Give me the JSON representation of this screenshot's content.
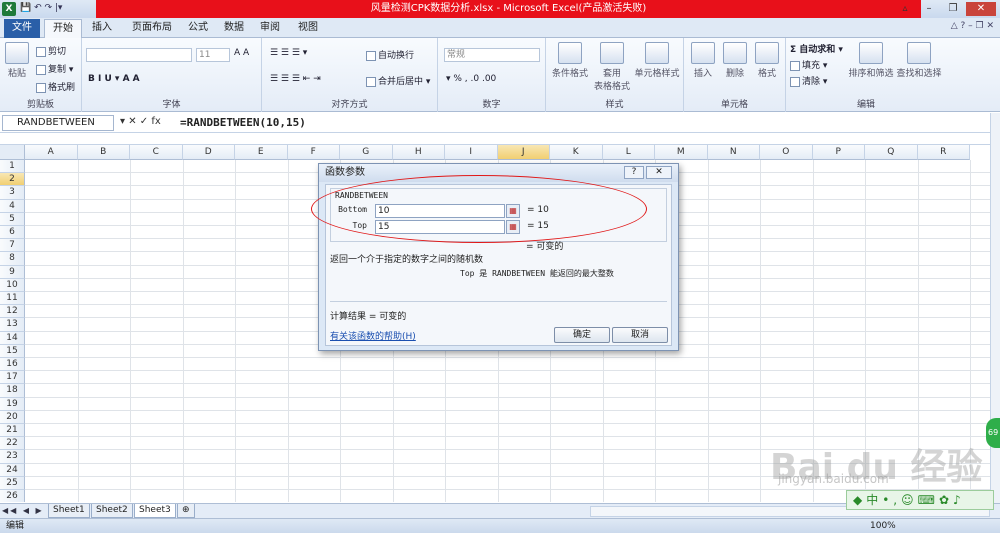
{
  "window": {
    "title": "风量检测CPK数据分析.xlsx  -  Microsoft Excel(产品激活失败)",
    "app_icon": "X",
    "qat": "💾 ↶ ↷ |▾"
  },
  "tabs": [
    "文件",
    "开始",
    "插入",
    "页面布局",
    "公式",
    "数据",
    "审阅",
    "视图"
  ],
  "ribbon": {
    "clipboard": {
      "paste": "粘贴",
      "cut": "剪切",
      "copy": "复制 ▾",
      "format_painter": "格式刷",
      "label": "剪贴板"
    },
    "font": {
      "font_name": "",
      "font_size": "11",
      "label": "字体",
      "buttons": "B  I  U ▾  A  A"
    },
    "alignment": {
      "wrap": "自动换行",
      "merge": "合并后居中 ▾",
      "label": "对齐方式"
    },
    "number": {
      "format": "常规",
      "buttons": "▾ %  ,  .0  .00",
      "label": "数字"
    },
    "styles": {
      "conditional": "条件格式",
      "table": "套用\n表格格式",
      "cell": "单元格样式",
      "label": "样式"
    },
    "cells": {
      "insert": "插入",
      "delete": "删除",
      "format": "格式",
      "label": "单元格"
    },
    "editing": {
      "autosum": "Σ 自动求和 ▾",
      "fill": "填充 ▾",
      "clear": "清除 ▾",
      "sort": "排序和筛选",
      "find": "查找和选择",
      "label": "编辑"
    }
  },
  "formula_bar": {
    "name_box": "RANDBETWEEN",
    "buttons": "▾  ✕  ✓  fx",
    "formula": "=RANDBETWEEN(10,15)"
  },
  "grid": {
    "columns": [
      "A",
      "B",
      "C",
      "D",
      "E",
      "F",
      "G",
      "H",
      "I",
      "J",
      "K",
      "L",
      "M",
      "N",
      "O",
      "P",
      "Q",
      "R"
    ],
    "selected_column": "J",
    "rows": [
      "1",
      "2",
      "3",
      "4",
      "5",
      "6",
      "7",
      "8",
      "9",
      "10",
      "11",
      "12",
      "13",
      "14",
      "15",
      "16",
      "17",
      "18",
      "19",
      "20",
      "21",
      "22",
      "23",
      "24",
      "25",
      "26"
    ],
    "selected_row": "2"
  },
  "dialog": {
    "title": "函数参数",
    "help_btn": "?",
    "close_btn": "✕",
    "function_name": "RANDBETWEEN",
    "args": [
      {
        "label": "Bottom",
        "value": "10",
        "result": "=  10"
      },
      {
        "label": "Top",
        "value": "15",
        "result": "=  15"
      }
    ],
    "result_line": "=  可变的",
    "description": "返回一个介于指定的数字之间的随机数",
    "arg_description": "Top  是  RANDBETWEEN  能返回的最大整数",
    "calc_result": "计算结果 =   可变的",
    "help_link": "有关该函数的帮助(H)",
    "ok": "确定",
    "cancel": "取消"
  },
  "sheets": [
    "Sheet1",
    "Sheet2",
    "Sheet3"
  ],
  "active_sheet": "Sheet3",
  "status": {
    "mode": "编辑",
    "zoom": "100%"
  },
  "watermark": {
    "text": "Bai du 经验",
    "sub": "jingyan.baidu.com",
    "float": "◆中•,☺⌨✿♪"
  },
  "badge": "69"
}
